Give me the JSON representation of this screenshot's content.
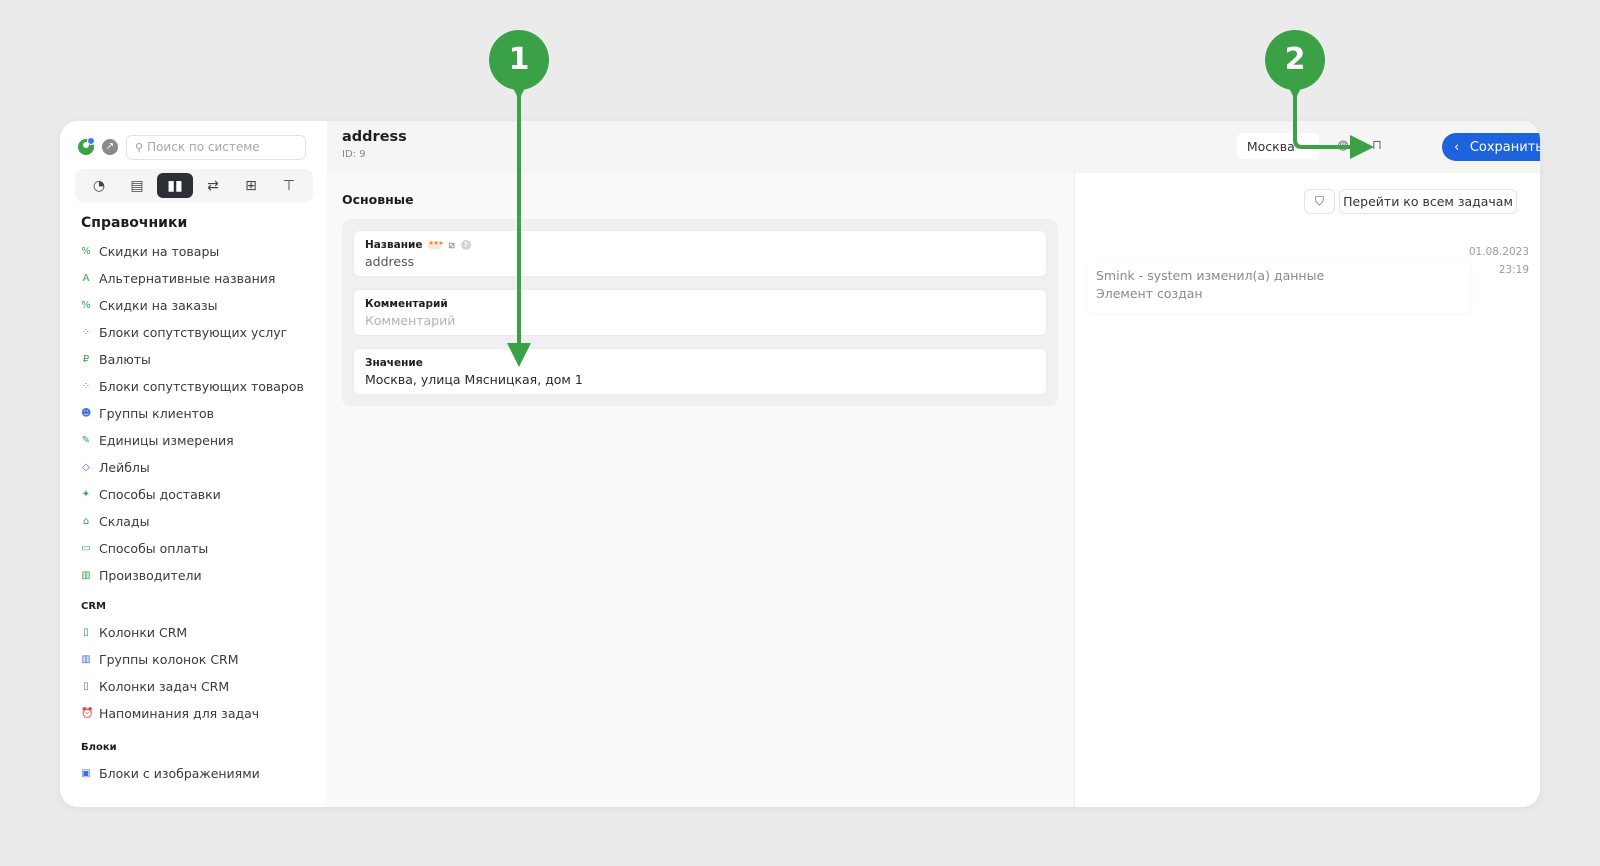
{
  "search": {
    "placeholder": "Поиск по системе"
  },
  "sidebar": {
    "tabs": [
      "speedometer-icon",
      "image-icon",
      "book-icon",
      "sliders-icon",
      "plus-square-icon",
      "stamp-icon"
    ],
    "section_title": "Справочники",
    "items": [
      {
        "label": "Скидки на товары",
        "icon": "percent-icon",
        "glyph": "%",
        "color": "green"
      },
      {
        "label": "Альтернативные названия",
        "icon": "letter-a-icon",
        "glyph": "A",
        "color": "green"
      },
      {
        "label": "Скидки на заказы",
        "icon": "percent-icon",
        "glyph": "%",
        "color": "green"
      },
      {
        "label": "Блоки сопутствующих услуг",
        "icon": "grid-icon",
        "glyph": "⁘",
        "color": "green"
      },
      {
        "label": "Валюты",
        "icon": "ruble-icon",
        "glyph": "₽",
        "color": "green"
      },
      {
        "label": "Блоки сопутствующих товаров",
        "icon": "grid-icon",
        "glyph": "⁘",
        "color": "green"
      },
      {
        "label": "Группы клиентов",
        "icon": "users-icon",
        "glyph": "☻",
        "color": "blue"
      },
      {
        "label": "Единицы измерения",
        "icon": "ruler-icon",
        "glyph": "✎",
        "color": "green"
      },
      {
        "label": "Лейблы",
        "icon": "tag-icon",
        "glyph": "◇",
        "color": "blue"
      },
      {
        "label": "Способы доставки",
        "icon": "walk-icon",
        "glyph": "✦",
        "color": "green"
      },
      {
        "label": "Склады",
        "icon": "warehouse-icon",
        "glyph": "⌂",
        "color": "green"
      },
      {
        "label": "Способы оплаты",
        "icon": "card-icon",
        "glyph": "▭",
        "color": "green"
      },
      {
        "label": "Производители",
        "icon": "factory-icon",
        "glyph": "▥",
        "color": "green"
      }
    ],
    "crm_title": "CRM",
    "crm_items": [
      {
        "label": "Колонки CRM",
        "icon": "column-icon",
        "glyph": "▯",
        "color": "blue"
      },
      {
        "label": "Группы колонок CRM",
        "icon": "columns-icon",
        "glyph": "▥",
        "color": "blue"
      },
      {
        "label": "Колонки задач CRM",
        "icon": "column-icon",
        "glyph": "▯",
        "color": "blue"
      },
      {
        "label": "Напоминания для задач",
        "icon": "alarm-icon",
        "glyph": "⏰",
        "color": "blue"
      }
    ],
    "blocks_title": "Блоки",
    "blocks_items": [
      {
        "label": "Блоки с изображениями",
        "icon": "image-icon",
        "glyph": "▣",
        "color": "blue"
      }
    ]
  },
  "header": {
    "title": "address",
    "id": "ID: 9",
    "city": "Москва",
    "save_label": "Сохранить"
  },
  "main": {
    "section_title": "Основные",
    "fields": {
      "name_label": "Название",
      "name_value": "address",
      "comment_label": "Комментарий",
      "comment_placeholder": "Комментарий",
      "value_label": "Значение",
      "value_value": "Москва, улица Мясницкая, дом 1"
    }
  },
  "right": {
    "tasks_button": "Перейти ко всем задачам",
    "history": {
      "date": "01.08.2023",
      "time": "23:19",
      "who": "Smink - system изменил(а) данные",
      "what": "Элемент создан"
    }
  },
  "annotations": {
    "marker1": "1",
    "marker2": "2"
  },
  "colors": {
    "accent": "#1d63de",
    "annotation": "#3aa146"
  }
}
